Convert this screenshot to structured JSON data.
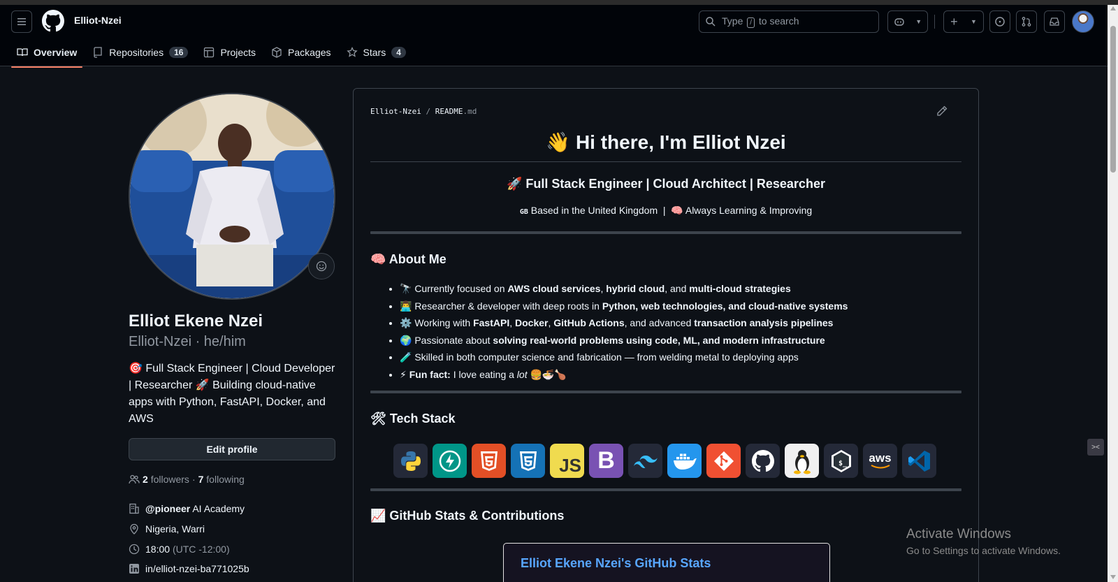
{
  "header": {
    "username": "Elliot-Nzei",
    "search_prefix": "Type",
    "search_key": "/",
    "search_suffix": "to search"
  },
  "tabs": [
    {
      "label": "Overview",
      "count": null
    },
    {
      "label": "Repositories",
      "count": "16"
    },
    {
      "label": "Projects",
      "count": null
    },
    {
      "label": "Packages",
      "count": null
    },
    {
      "label": "Stars",
      "count": "4"
    }
  ],
  "profile": {
    "full_name": "Elliot Ekene Nzei",
    "login_pronouns": "Elliot-Nzei · he/him",
    "bio": "🎯 Full Stack Engineer | Cloud Developer | Researcher 🚀 Building cloud-native apps with Python, FastAPI, Docker, and AWS",
    "edit_button": "Edit profile",
    "followers_count": "2",
    "followers_label": "followers",
    "following_count": "7",
    "following_label": "following",
    "org_handle": "@pioneer",
    "org_rest": "AI Academy",
    "location": "Nigeria, Warri",
    "time": "18:00",
    "timezone": "(UTC -12:00)",
    "linkedin": "in/elliot-nzei-ba771025b"
  },
  "readme": {
    "path_user": "Elliot-Nzei",
    "path_sep": "/",
    "path_file": "README",
    "path_ext": ".md",
    "heading": "👋 Hi there, I'm Elliot Nzei",
    "subtitle": "🚀 Full Stack Engineer | Cloud Architect | Researcher",
    "location_flag": "GB",
    "location_text": "Based in the United Kingdom",
    "location_sep": "|",
    "learning_text": "🧠 Always Learning & Improving",
    "about_title": "🧠 About Me",
    "about_items": [
      {
        "pre": "🔭 Currently focused on ",
        "b1": "AWS cloud services",
        "m1": ", ",
        "b2": "hybrid cloud",
        "m2": ", and ",
        "b3": "multi-cloud strategies",
        "post": ""
      },
      {
        "pre": "👨‍💻 Researcher & developer with deep roots in ",
        "b1": "Python, web technologies, and cloud-native systems",
        "m1": "",
        "b2": "",
        "m2": "",
        "b3": "",
        "post": ""
      },
      {
        "pre": "⚙️ Working with ",
        "b1": "FastAPI",
        "m1": ", ",
        "b2": "Docker",
        "m2": ", ",
        "b3": "GitHub Actions",
        "post": ", and advanced ",
        "b4": "transaction analysis pipelines"
      },
      {
        "pre": "🌍 Passionate about ",
        "b1": "solving real-world problems using code, ML, and modern infrastructure",
        "m1": "",
        "b2": "",
        "m2": "",
        "b3": "",
        "post": ""
      },
      {
        "pre": "🧪 Skilled in both computer science and fabrication — from welding metal to deploying apps",
        "b1": "",
        "m1": "",
        "b2": "",
        "m2": "",
        "b3": "",
        "post": ""
      },
      {
        "pre": "⚡ ",
        "b1": "Fun fact:",
        "m1": " I love eating a ",
        "i1": "lot",
        "post": " 🍔🍜🍗"
      }
    ],
    "tech_title": "🛠 Tech Stack",
    "tech_icons": [
      "python-icon",
      "fastapi-icon",
      "html5-icon",
      "css3-icon",
      "javascript-icon",
      "bootstrap-icon",
      "tailwind-icon",
      "docker-icon",
      "git-icon",
      "github-icon",
      "linux-icon",
      "bash-icon",
      "aws-icon",
      "vscode-icon"
    ],
    "stats_title": "📈 GitHub Stats & Contributions",
    "stats_card_title": "Elliot Ekene Nzei's GitHub Stats"
  },
  "os": {
    "activate_title": "Activate Windows",
    "activate_sub": "Go to Settings to activate Windows."
  },
  "colors": {
    "accent_tab_underline": "#f78166",
    "link": "#58a6ff",
    "background": "#0d1117"
  }
}
